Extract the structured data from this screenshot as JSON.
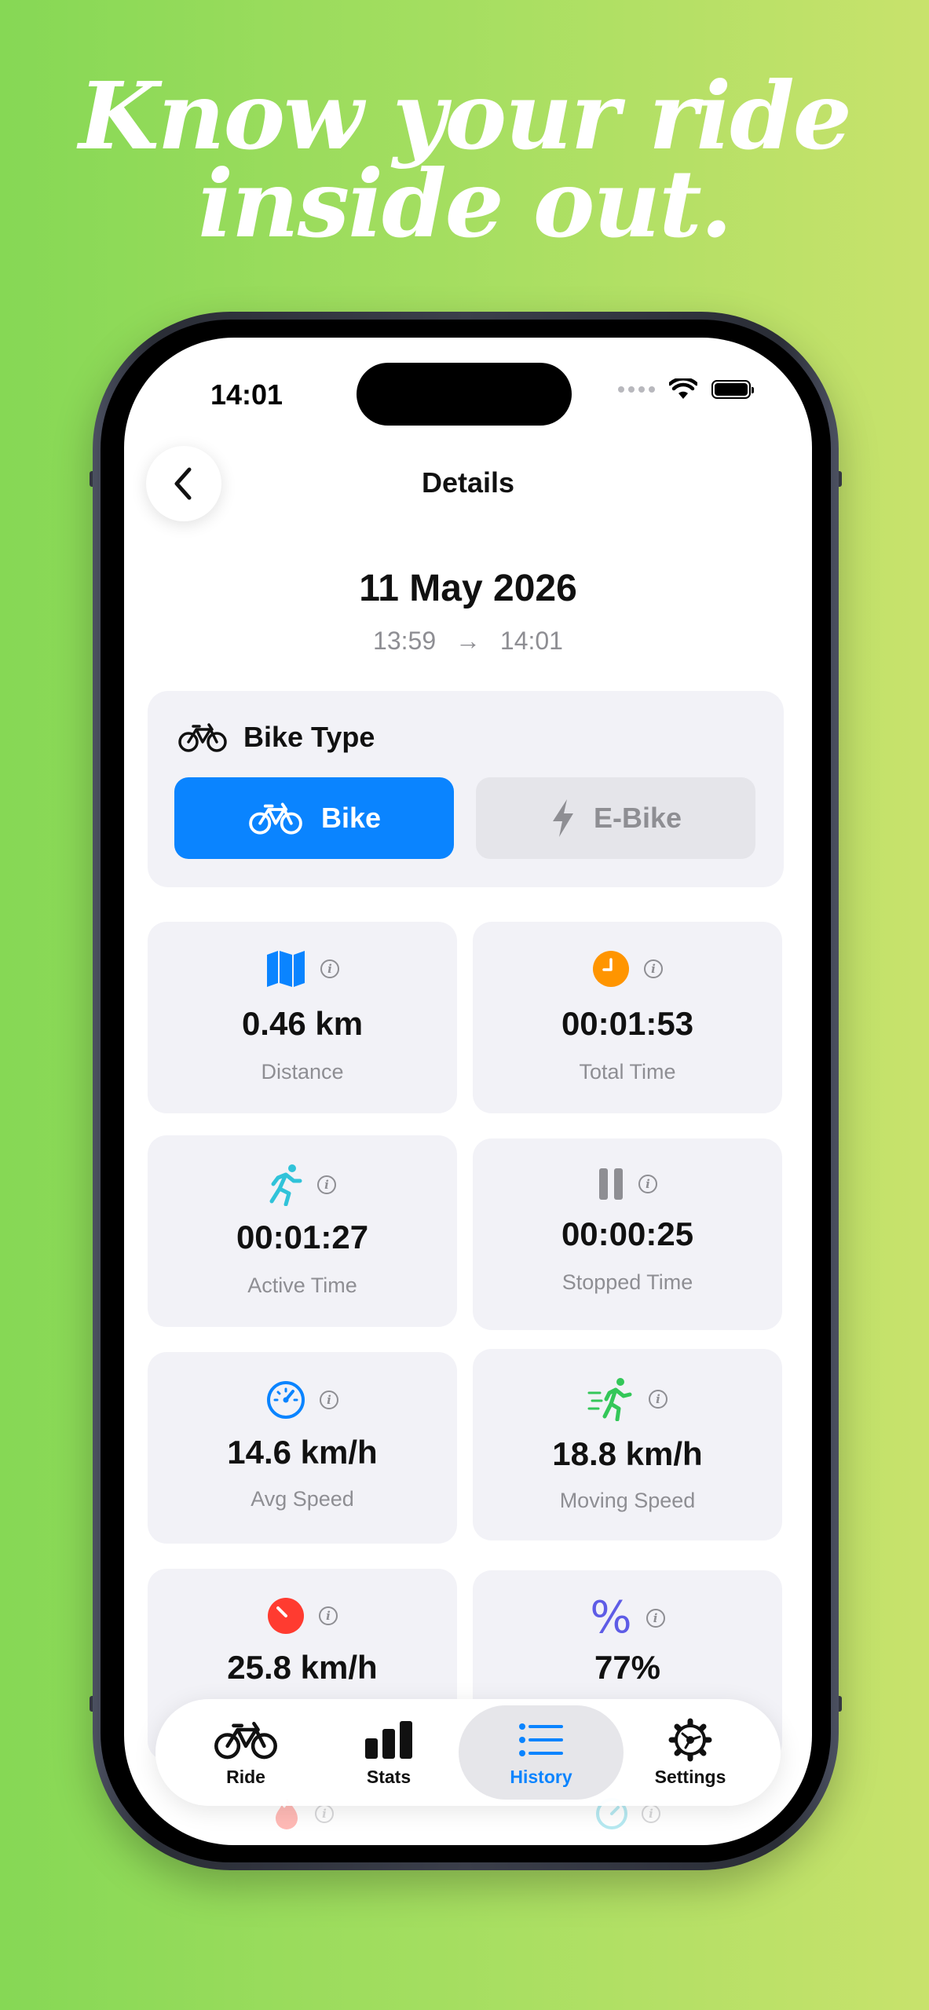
{
  "headline": {
    "line1": "Know your ride",
    "line2": "inside out."
  },
  "status_bar": {
    "time": "14:01"
  },
  "nav": {
    "title": "Details"
  },
  "ride": {
    "date": "11 May 2026",
    "start": "13:59",
    "end": "14:01"
  },
  "bike_type": {
    "label": "Bike Type",
    "options": [
      {
        "label": "Bike",
        "selected": true
      },
      {
        "label": "E-Bike",
        "selected": false
      }
    ]
  },
  "stats": [
    {
      "value": "0.46 km",
      "label": "Distance",
      "icon": "map-icon",
      "color": "#0a84ff"
    },
    {
      "value": "00:01:53",
      "label": "Total Time",
      "icon": "clock-icon",
      "color": "#ff9500"
    },
    {
      "value": "00:01:27",
      "label": "Active Time",
      "icon": "running-icon",
      "color": "#30c3d9"
    },
    {
      "value": "00:00:25",
      "label": "Stopped Time",
      "icon": "pause-icon",
      "color": "#8e8e93"
    },
    {
      "value": "14.6 km/h",
      "label": "Avg Speed",
      "icon": "speedometer-icon",
      "color": "#0a84ff"
    },
    {
      "value": "18.8 km/h",
      "label": "Moving Speed",
      "icon": "moving-figure-icon",
      "color": "#34c759"
    },
    {
      "value": "25.8 km/h",
      "label": "",
      "icon": "max-speed-gauge-icon",
      "color": "#ff3b30"
    },
    {
      "value": "77%",
      "label": "",
      "icon": "percent-icon",
      "color": "#5e5ce6"
    }
  ],
  "tabs": [
    {
      "label": "Ride",
      "icon": "bicycle-icon",
      "active": false
    },
    {
      "label": "Stats",
      "icon": "bar-chart-icon",
      "active": false
    },
    {
      "label": "History",
      "icon": "list-icon",
      "active": true
    },
    {
      "label": "Settings",
      "icon": "gear-icon",
      "active": false
    }
  ]
}
